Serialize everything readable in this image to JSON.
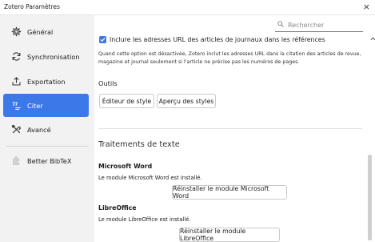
{
  "window": {
    "title": "Zotero Paramètres",
    "close": "×"
  },
  "sidebar": {
    "items": [
      {
        "label": "Général",
        "icon": "gear-icon"
      },
      {
        "label": "Synchronisation",
        "icon": "sync-icon"
      },
      {
        "label": "Exportation",
        "icon": "export-icon"
      },
      {
        "label": "Citer",
        "icon": "cite-icon",
        "active": true
      },
      {
        "label": "Avancé",
        "icon": "tools-icon"
      },
      {
        "label": "Better BibTeX",
        "icon": "plugin-icon"
      }
    ]
  },
  "search": {
    "placeholder": "Rechercher"
  },
  "citer": {
    "include_urls_label": "Inclure les adresses URL des articles de journaux dans les références",
    "include_urls_desc_1": "Quand cette option est désactivée, Zotero inclut les adresses URL dans la citation des articles de revue,",
    "include_urls_desc_2": "magazine et journal seulement si l'article ne précise pas les numéros de pages.",
    "outils_heading": "Outils",
    "style_editor_button": "Éditeur de style",
    "style_preview_button": "Aperçu des styles",
    "word_processors_heading": "Traitements de texte",
    "msword_heading": "Microsoft Word",
    "msword_status": "Le module Microsoft Word est installé.",
    "msword_reinstall_button": "Réinstaller le module Microsoft Word",
    "libreoffice_heading": "LibreOffice",
    "libreoffice_status": "Le module LibreOffice est installé.",
    "libreoffice_reinstall_button": "Réinstaller le module LibreOffice"
  },
  "colors": {
    "accent": "#3c78e8",
    "sidebar_bg": "#f2f2f2"
  }
}
